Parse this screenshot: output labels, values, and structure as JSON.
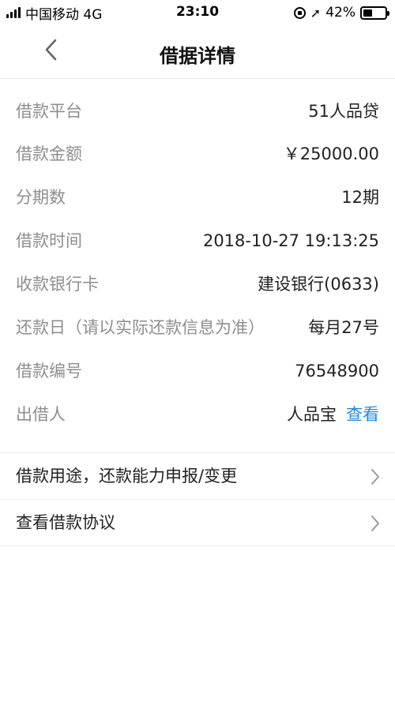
{
  "status_bar": {
    "carrier": "中国移动 4G",
    "time": "23:10",
    "battery_percent": "42%",
    "battery_level": 0.42,
    "signal_icon": "signal-bars-icon",
    "location_icon": "location-arrow-icon"
  },
  "nav": {
    "title": "借据详情",
    "back_icon": "chevron-left-icon"
  },
  "details": [
    {
      "label": "借款平台",
      "value": "51人品贷"
    },
    {
      "label": "借款金额",
      "value": "￥25000.00"
    },
    {
      "label": "分期数",
      "value": "12期"
    },
    {
      "label": "借款时间",
      "value": "2018-10-27 19:13:25"
    },
    {
      "label": "收款银行卡",
      "value": "建设银行(0633)"
    },
    {
      "label": "还款日（请以实际还款信息为准）",
      "value": "每月27号"
    },
    {
      "label": "借款编号",
      "value": "76548900"
    },
    {
      "label": "出借人",
      "value": "人品宝",
      "link": "查看"
    }
  ],
  "menu": [
    {
      "label": "借款用途，还款能力申报/变更",
      "icon": "chevron-right-icon"
    },
    {
      "label": "查看借款协议",
      "icon": "chevron-right-icon"
    }
  ],
  "colors": {
    "label": "#8e8e8e",
    "link": "#1e8bdc",
    "divider": "#ececec"
  }
}
